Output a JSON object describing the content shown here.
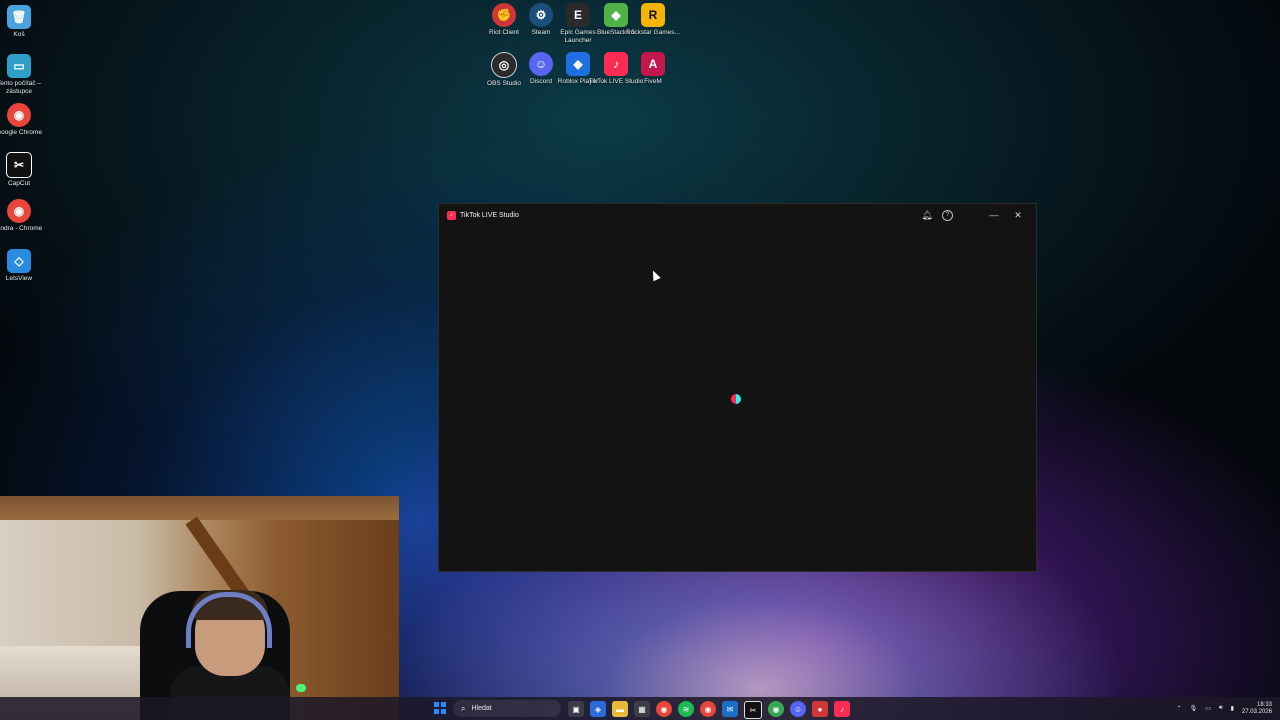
{
  "desktop_left": [
    {
      "label": "Koš",
      "icon": "recycle-bin-icon",
      "color": "#4aa3df",
      "glyph": "🗑"
    },
    {
      "label": "Tento počítač – zástupce",
      "icon": "this-pc-icon",
      "color": "#2ea0c8",
      "glyph": "▭"
    },
    {
      "label": "Google Chrome",
      "icon": "chrome-icon",
      "color": "#e8453c",
      "glyph": "◉"
    },
    {
      "label": "CapCut",
      "icon": "capcut-icon",
      "color": "#111111",
      "glyph": "✂"
    },
    {
      "label": "Jindra - Chrome",
      "icon": "chrome-profile-icon",
      "color": "#e8453c",
      "glyph": "◉"
    },
    {
      "label": "LetsView",
      "icon": "letsview-icon",
      "color": "#2b8be0",
      "glyph": "◇"
    }
  ],
  "desktop_top_row1": [
    {
      "label": "Riot Client",
      "icon": "riot-client-icon",
      "color": "#d13639",
      "glyph": "✊"
    },
    {
      "label": "Steam",
      "icon": "steam-icon",
      "color": "#1b4f7a",
      "glyph": "⚙"
    },
    {
      "label": "Epic Games Launcher",
      "icon": "epic-games-icon",
      "color": "#2a2a2a",
      "glyph": "E"
    },
    {
      "label": "BlueStacks 5",
      "icon": "bluestacks-icon",
      "color": "#4fb34a",
      "glyph": "◆"
    },
    {
      "label": "Rockstar Games...",
      "icon": "rockstar-icon",
      "color": "#f5b400",
      "glyph": "R"
    }
  ],
  "desktop_top_row2": [
    {
      "label": "OBS Studio",
      "icon": "obs-icon",
      "color": "#2b2b2b",
      "glyph": "◎"
    },
    {
      "label": "Discord",
      "icon": "discord-icon",
      "color": "#5865f2",
      "glyph": "☺"
    },
    {
      "label": "Roblox Player",
      "icon": "roblox-icon",
      "color": "#1f6fe0",
      "glyph": "◆"
    },
    {
      "label": "TikTok LIVE Studio",
      "icon": "tiktok-live-studio-icon",
      "color": "#fe2c55",
      "glyph": "♪"
    },
    {
      "label": "FiveM",
      "icon": "fivem-icon",
      "color": "#c2184b",
      "glyph": "A"
    }
  ],
  "window": {
    "title": "TikTok LIVE Studio"
  },
  "taskbar": {
    "search_placeholder": "Hledat",
    "apps": [
      {
        "icon": "task-view-icon",
        "color": "#3a3a4a",
        "glyph": "▣"
      },
      {
        "icon": "copilot-icon",
        "color": "#2b6ad8",
        "glyph": "◈"
      },
      {
        "icon": "file-explorer-icon",
        "color": "#e9b93a",
        "glyph": "▬"
      },
      {
        "icon": "store-icon",
        "color": "#3e3e48",
        "glyph": "▦"
      },
      {
        "icon": "chrome-icon",
        "color": "#e8453c",
        "glyph": "◉"
      },
      {
        "icon": "spotify-icon",
        "color": "#1db954",
        "glyph": "≋"
      },
      {
        "icon": "chrome-profile-icon",
        "color": "#e8453c",
        "glyph": "◉"
      },
      {
        "icon": "outlook-icon",
        "color": "#1b6fc9",
        "glyph": "✉"
      },
      {
        "icon": "capcut-icon",
        "color": "#111111",
        "glyph": "✂"
      },
      {
        "icon": "chrome-alt-icon",
        "color": "#35a853",
        "glyph": "◉"
      },
      {
        "icon": "discord-icon",
        "color": "#5865f2",
        "glyph": "☺"
      },
      {
        "icon": "record-icon",
        "color": "#d13639",
        "glyph": "●"
      },
      {
        "icon": "tiktok-live-studio-icon",
        "color": "#fe2c55",
        "glyph": "♪"
      }
    ],
    "time": "18:33",
    "date": "27.03.2026"
  }
}
